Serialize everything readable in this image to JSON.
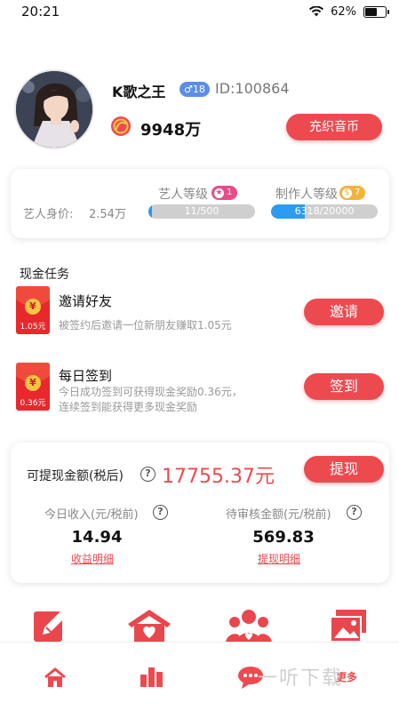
{
  "status": {
    "time": "20:21",
    "battery": "62%",
    "battery_fraction": 0.62
  },
  "profile": {
    "nickname": "K歌之王",
    "gender_badge": "♂18",
    "user_id": "ID:100864",
    "coins": "9948万",
    "recharge_label": "充织音币"
  },
  "levels": {
    "worth_label": "艺人身价:",
    "worth_value": "2.54万",
    "artist": {
      "label": "艺人等级",
      "badge": "1",
      "progress_text": "11/500",
      "progress": 0.022
    },
    "producer": {
      "label": "制作人等级",
      "badge": "7",
      "progress_text": "6318/20000",
      "progress": 0.316
    }
  },
  "tasks": {
    "section_title": "现金任务",
    "invite": {
      "envelope_amount": "1.05元",
      "title": "邀请好友",
      "desc": "被签约后邀请一位新朋友赚取1.05元",
      "button": "邀请"
    },
    "checkin": {
      "envelope_amount": "0.36元",
      "title": "每日签到",
      "desc1": "今日成功签到可获得现金奖励0.36元，",
      "desc2": "连续签到能获得更多现金奖励",
      "button": "签到"
    }
  },
  "cash": {
    "label": "可提现金额(税后)",
    "amount": "17755.37元",
    "withdraw_label": "提现",
    "today": {
      "label": "今日收入(元/税前)",
      "value": "14.94",
      "link": "收益明细"
    },
    "pending": {
      "label": "待审核金额(元/税前)",
      "value": "569.83",
      "link": "提现明细"
    }
  },
  "tabbar": {
    "more_label": "更多",
    "watermark": "一听下载"
  },
  "colors": {
    "accent": "#ed4a50",
    "progress": "#2c9bf0",
    "artist_badge": "#e84b8a",
    "producer_badge": "#f2b33d"
  }
}
